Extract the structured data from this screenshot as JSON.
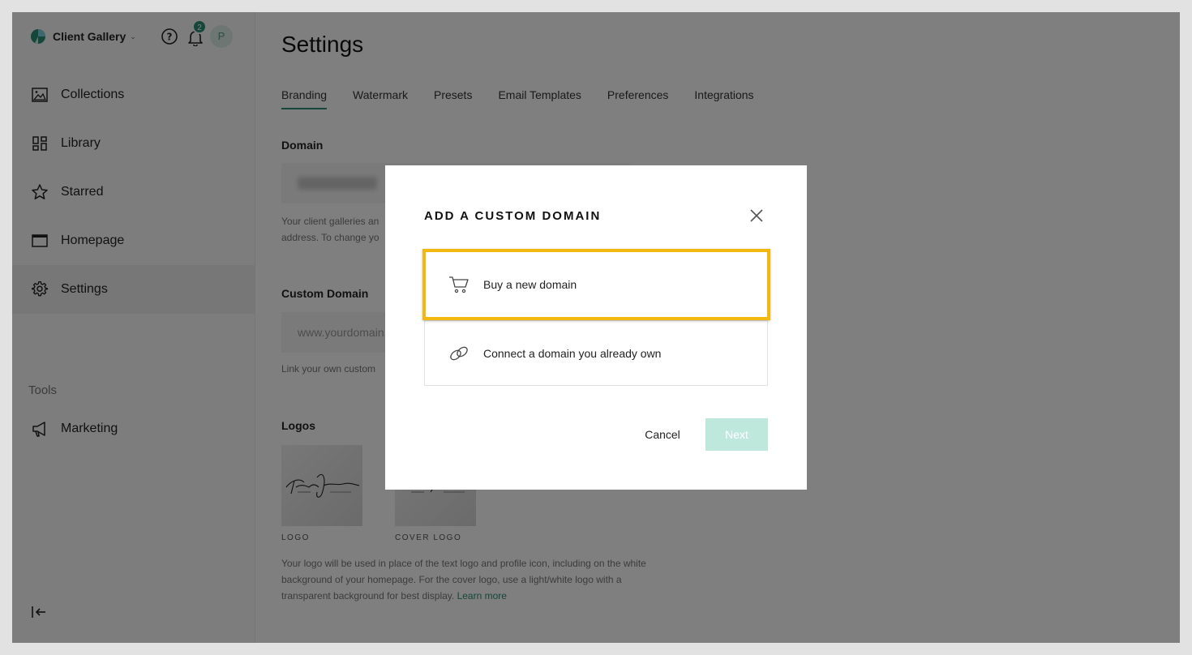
{
  "app": {
    "name": "Client Gallery",
    "notification_count": "2",
    "avatar_initial": "P"
  },
  "sidebar": {
    "items": [
      {
        "label": "Collections",
        "icon": "image-icon"
      },
      {
        "label": "Library",
        "icon": "grid-icon"
      },
      {
        "label": "Starred",
        "icon": "star-icon"
      },
      {
        "label": "Homepage",
        "icon": "window-icon"
      },
      {
        "label": "Settings",
        "icon": "gear-icon",
        "active": true
      }
    ],
    "tools_heading": "Tools",
    "tools": [
      {
        "label": "Marketing",
        "icon": "megaphone-icon"
      }
    ]
  },
  "main": {
    "title": "Settings",
    "tabs": [
      {
        "label": "Branding",
        "active": true
      },
      {
        "label": "Watermark"
      },
      {
        "label": "Presets"
      },
      {
        "label": "Email Templates"
      },
      {
        "label": "Preferences"
      },
      {
        "label": "Integrations"
      }
    ],
    "domain_label": "Domain",
    "domain_help_line1": "Your client galleries an",
    "domain_help_line2": "address. To change yo",
    "custom_domain_label": "Custom Domain",
    "custom_domain_placeholder": "www.yourdomain.",
    "custom_domain_help": "Link your own custom",
    "logos_label": "Logos",
    "logo_caption": "LOGO",
    "cover_logo_caption": "COVER LOGO",
    "logos_help_line1": "Your logo will be used in place of the text logo and profile icon, including on the white",
    "logos_help_line2": "background of your homepage. For the cover logo, use a light/white logo with a",
    "logos_help_line3": "transparent background for best display.",
    "learn_more": "Learn more"
  },
  "modal": {
    "title": "ADD A CUSTOM DOMAIN",
    "options": [
      {
        "label": "Buy a new domain",
        "icon": "cart-icon",
        "highlighted": true
      },
      {
        "label": "Connect a domain you already own",
        "icon": "link-icon"
      }
    ],
    "cancel_label": "Cancel",
    "next_label": "Next"
  },
  "colors": {
    "accent": "#2a8c74",
    "highlight": "#f2b80f",
    "next_disabled": "#bfe8dc"
  }
}
